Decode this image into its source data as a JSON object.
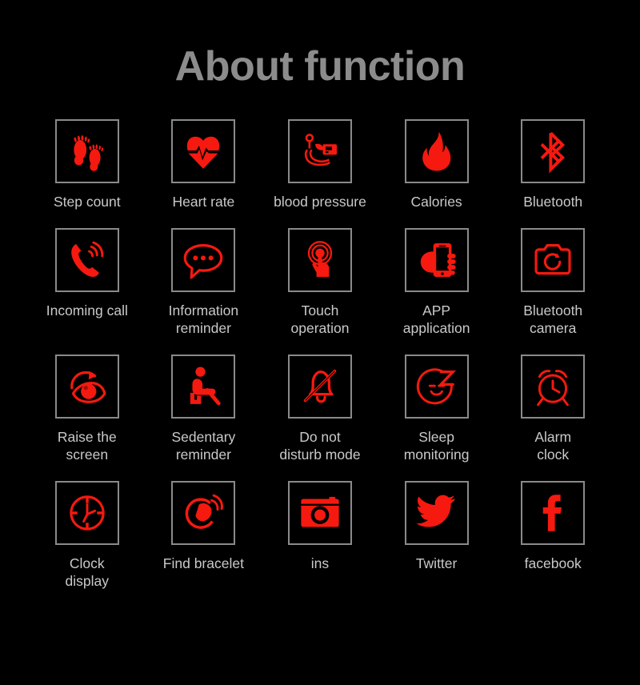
{
  "header": {
    "title": "About function",
    "title_color": "#8c8c8c"
  },
  "theme": {
    "background": "#000000",
    "icon_color": "#f5190f",
    "icon_border_color": "#8a8a8a",
    "label_color": "#c9c9c9"
  },
  "grid": {
    "columns": 5,
    "rows": 4,
    "items": [
      {
        "label": "Step count",
        "icon": "footprints-icon"
      },
      {
        "label": "Heart rate",
        "icon": "heart-pulse-icon"
      },
      {
        "label": "blood pressure",
        "icon": "blood-pressure-monitor-icon"
      },
      {
        "label": "Calories",
        "icon": "flame-icon"
      },
      {
        "label": "Bluetooth",
        "icon": "bluetooth-icon"
      },
      {
        "label": "Incoming call",
        "icon": "ringing-phone-icon"
      },
      {
        "label": "Information\nreminder",
        "icon": "speech-bubble-icon"
      },
      {
        "label": "Touch\noperation",
        "icon": "touch-gesture-icon"
      },
      {
        "label": "APP\napplication",
        "icon": "hand-holding-phone-icon"
      },
      {
        "label": "Bluetooth\ncamera",
        "icon": "camera-icon"
      },
      {
        "label": "Raise the\nscreen",
        "icon": "eye-rotate-icon"
      },
      {
        "label": "Sedentary\nreminder",
        "icon": "seated-person-icon"
      },
      {
        "label": "Do not\ndisturb mode",
        "icon": "bell-slash-icon"
      },
      {
        "label": "Sleep\nmonitoring",
        "icon": "sleeping-face-z-icon"
      },
      {
        "label": "Alarm\nclock",
        "icon": "alarm-clock-icon"
      },
      {
        "label": "Clock\ndisplay",
        "icon": "clock-face-icon"
      },
      {
        "label": "Find bracelet",
        "icon": "vibrating-bracelet-icon"
      },
      {
        "label": "ins",
        "icon": "instagram-icon"
      },
      {
        "label": "Twitter",
        "icon": "twitter-bird-icon"
      },
      {
        "label": "facebook",
        "icon": "facebook-f-icon"
      }
    ]
  }
}
